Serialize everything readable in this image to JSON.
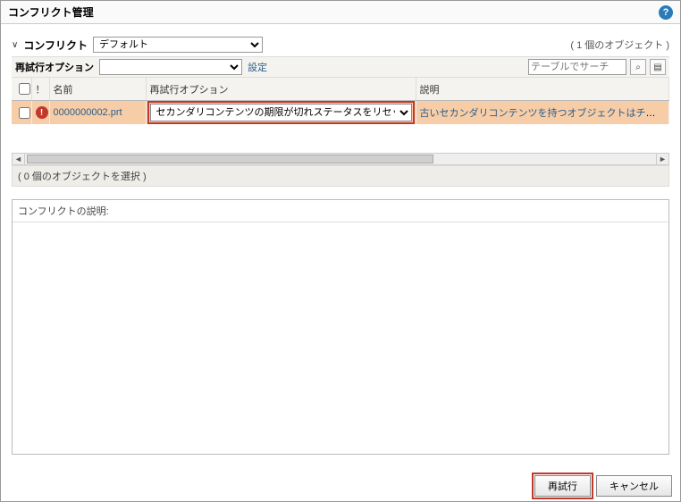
{
  "header": {
    "title": "コンフリクト管理",
    "help_icon": "?"
  },
  "section": {
    "chevron": "∨",
    "title": "コンフリクト",
    "filter_options": [
      "デフォルト"
    ],
    "filter_selected": "デフォルト",
    "object_count": "( 1 個のオブジェクト )"
  },
  "toolbar": {
    "retry_label": "再試行オプション",
    "global_options": [
      ""
    ],
    "config_link": "設定",
    "search_placeholder": "テーブルでサーチ",
    "search_glyph": "⌕",
    "view_glyph": "▤"
  },
  "table": {
    "headers": {
      "checkbox": "",
      "index": "！",
      "name": "名前",
      "retry": "再試行オプション",
      "desc": "説明"
    },
    "rows": [
      {
        "checked": false,
        "error_glyph": "!",
        "name": "0000000002.prt",
        "retry_selected": "セカンダリコンテンツの期限が切れステータスをリセット",
        "retry_options": [
          "セカンダリコンテンツの期限が切れステータスをリセット"
        ],
        "desc": "古いセカンダリコンテンツを持つオブジェクトはチェックイン"
      }
    ]
  },
  "scroll": {
    "left_glyph": "◄",
    "right_glyph": "►"
  },
  "status": "( 0 個のオブジェクトを選択 )",
  "desc_panel": {
    "title": "コンフリクトの説明:"
  },
  "footer": {
    "retry": "再試行",
    "cancel": "キャンセル"
  }
}
